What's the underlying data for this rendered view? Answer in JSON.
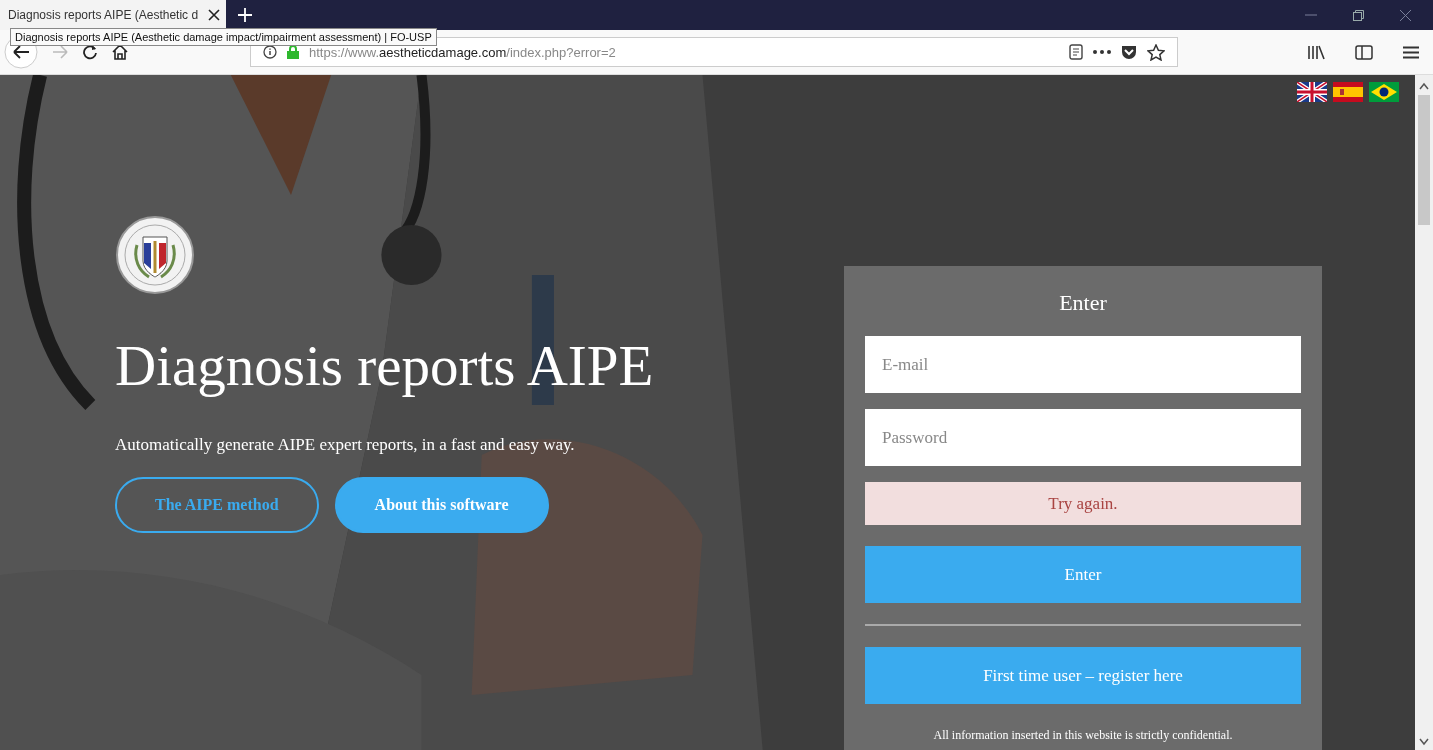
{
  "browser": {
    "tab_title": "Diagnosis reports AIPE (Aesthetic d",
    "tooltip": "Diagnosis reports AIPE (Aesthetic damage impact/impairment assessment) | FO-USP",
    "url_scheme": "https://www.",
    "url_host": "aestheticdamage.com",
    "url_path": "/index.php?error=2"
  },
  "languages": [
    {
      "kind": "uk"
    },
    {
      "kind": "es"
    },
    {
      "kind": "br"
    }
  ],
  "hero": {
    "title": "Diagnosis reports AIPE",
    "subtitle": "Automatically generate AIPE expert reports, in a fast and easy way.",
    "buttons": [
      {
        "label": "The AIPE method",
        "kind": "outline"
      },
      {
        "label": "About this software",
        "kind": "filled"
      }
    ]
  },
  "login": {
    "title": "Enter",
    "email": {
      "placeholder": "E-mail"
    },
    "password": {
      "placeholder": "Password"
    },
    "error": "Try again.",
    "submit": "Enter",
    "register": "First time user – register here",
    "note": "All information inserted in this website is strictly confidential."
  }
}
